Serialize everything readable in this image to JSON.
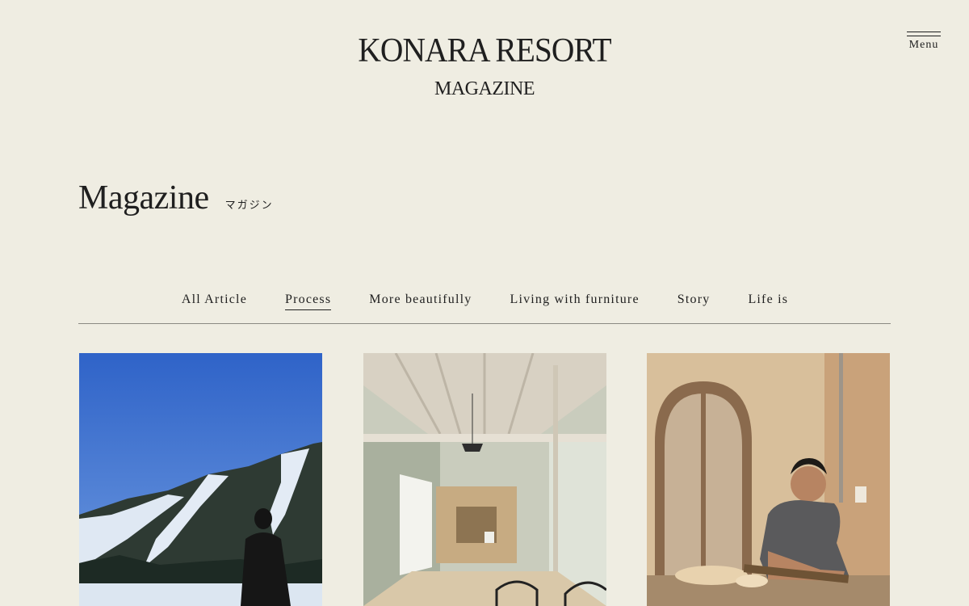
{
  "brand": {
    "title": "KONARA RESORT",
    "subtitle": "MAGAZINE"
  },
  "menu": {
    "label": "Menu",
    "icon": "hamburger-icon"
  },
  "page": {
    "title": "Magazine",
    "title_ja": "マガジン"
  },
  "tabs": [
    {
      "label": "All Article",
      "active": false
    },
    {
      "label": "Process",
      "active": true
    },
    {
      "label": "More beautifully",
      "active": false
    },
    {
      "label": "Living with furniture",
      "active": false
    },
    {
      "label": "Story",
      "active": false
    },
    {
      "label": "Life is",
      "active": false
    }
  ],
  "colors": {
    "background": "#efede2",
    "text": "#1f1f1f",
    "divider": "#8a8a82"
  }
}
